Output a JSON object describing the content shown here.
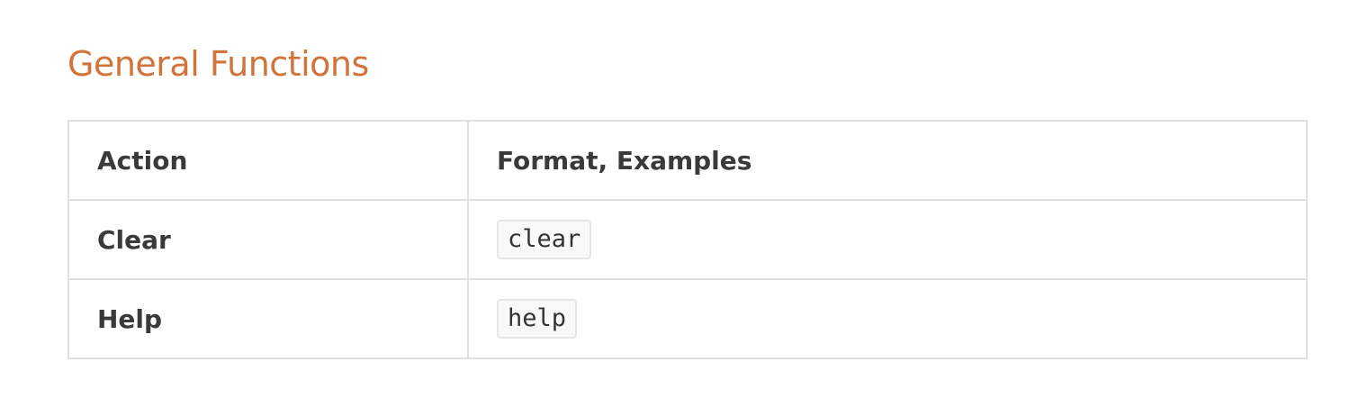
{
  "heading": "General Functions",
  "table": {
    "headers": [
      "Action",
      "Format, Examples"
    ],
    "rows": [
      {
        "action": "Clear",
        "format": "clear"
      },
      {
        "action": "Help",
        "format": "help"
      }
    ]
  },
  "colors": {
    "heading": "#d2743a",
    "text": "#333333",
    "border": "#e0e0e0",
    "code_background": "#f9f9f9"
  }
}
